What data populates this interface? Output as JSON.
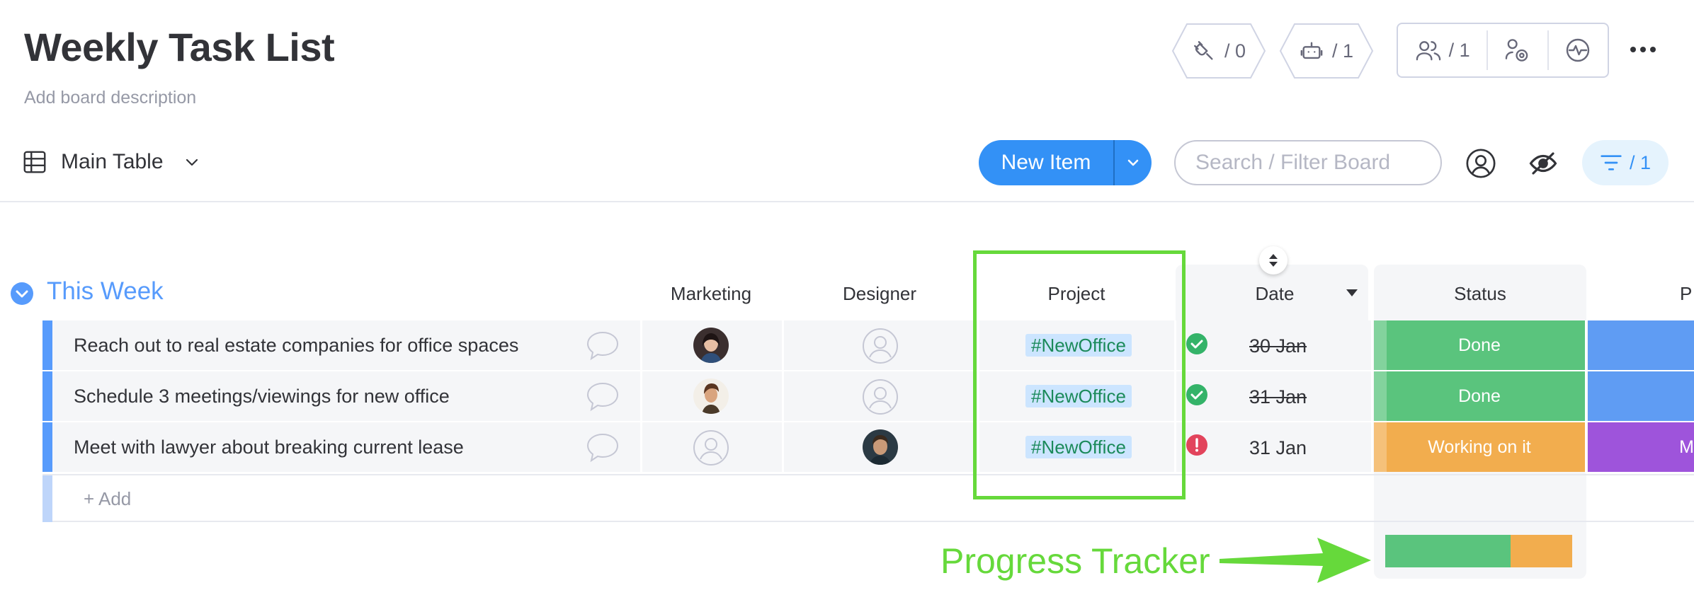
{
  "board": {
    "title": "Weekly Task List",
    "description_placeholder": "Add board description"
  },
  "header": {
    "integrations_count": "/ 0",
    "automations_count": "/ 1",
    "members_count": "/ 1"
  },
  "toolbar": {
    "view_label": "Main Table",
    "new_item_label": "New Item",
    "search_placeholder": "Search / Filter Board",
    "filter_count": "/ 1"
  },
  "group": {
    "title": "This Week",
    "color": "#579bfc",
    "columns": [
      "Marketing",
      "Designer",
      "Project",
      "Date",
      "Status",
      "P"
    ],
    "add_label": "+ Add"
  },
  "rows": [
    {
      "name": "Reach out to real estate companies for office spaces",
      "marketing": "avatar-woman",
      "designer": "empty",
      "project": "#NewOffice",
      "date": "30 Jan",
      "date_state": "done",
      "status": "Done",
      "status_color": "#5ac47d",
      "next_color": "#5f9cf3"
    },
    {
      "name": "Schedule 3 meetings/viewings for new office",
      "marketing": "avatar-man",
      "designer": "empty",
      "project": "#NewOffice",
      "date": "31 Jan",
      "date_state": "done",
      "status": "Done",
      "status_color": "#5ac47d",
      "next_color": "#5f9cf3"
    },
    {
      "name": "Meet with lawyer about breaking current lease",
      "marketing": "empty",
      "designer": "avatar-man-2",
      "project": "#NewOffice",
      "date": "31 Jan",
      "date_state": "overdue",
      "status": "Working on it",
      "status_color": "#f2ad4e",
      "next_color": "#9e54db",
      "next_label": "M"
    }
  ],
  "progress": {
    "done_fraction": 0.67,
    "working_fraction": 0.33,
    "done_color": "#5ac47d",
    "working_color": "#f2ad4e"
  },
  "annotation": {
    "label": "Progress Tracker",
    "color": "#66d93b"
  }
}
